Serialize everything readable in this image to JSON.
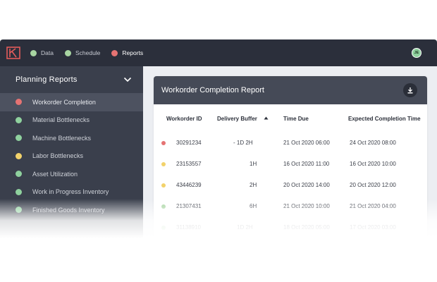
{
  "topbar": {
    "logo_icon": "brand-logo-icon",
    "nav": [
      {
        "label": "Data",
        "color": "#a8d5a2"
      },
      {
        "label": "Schedule",
        "color": "#a8d5a2"
      },
      {
        "label": "Reports",
        "color": "#e57373"
      }
    ],
    "avatar_initials": "JE"
  },
  "sidebar": {
    "title": "Planning Reports",
    "items": [
      {
        "label": "Workorder Completion",
        "color": "#e57373"
      },
      {
        "label": "Material Bottlenecks",
        "color": "#8fd19e"
      },
      {
        "label": "Machine Bottlenecks",
        "color": "#8fd19e"
      },
      {
        "label": "Labor Bottlenecks",
        "color": "#f2d26b"
      },
      {
        "label": "Asset Utilization",
        "color": "#8fd19e"
      },
      {
        "label": "Work in Progress Inventory",
        "color": "#8fd19e"
      },
      {
        "label": "Finished Goods Inventory",
        "color": "#8fd19e"
      }
    ]
  },
  "report": {
    "title": "Workorder Completion Report",
    "columns": [
      "Workorder ID",
      "Delivery Buffer",
      "Time Due",
      "Expected Completion Time"
    ],
    "rows": [
      {
        "id": "30291234",
        "buffer": "- 1D  2H",
        "due": "21 Oct 2020 06:00",
        "expected": "24 Oct 2020 08:00",
        "color": "#e57373"
      },
      {
        "id": "23153557",
        "buffer": "1H",
        "due": "16 Oct 2020 11:00",
        "expected": "16 Oct 2020 10:00",
        "color": "#f2d26b"
      },
      {
        "id": "43446239",
        "buffer": "2H",
        "due": "20 Oct 2020 14:00",
        "expected": "20 Oct 2020 12:00",
        "color": "#f2d26b"
      },
      {
        "id": "21307431",
        "buffer": "6H",
        "due": "21 Oct 2020 10:00",
        "expected": "21 Oct 2020 04:00",
        "color": "#a8d5a2"
      },
      {
        "id": "31138910",
        "buffer": "1D  2H",
        "due": "18 Oct 2020 05:00",
        "expected": "17 Oct 2020 03:00",
        "color": "#a8d5a2"
      }
    ]
  }
}
